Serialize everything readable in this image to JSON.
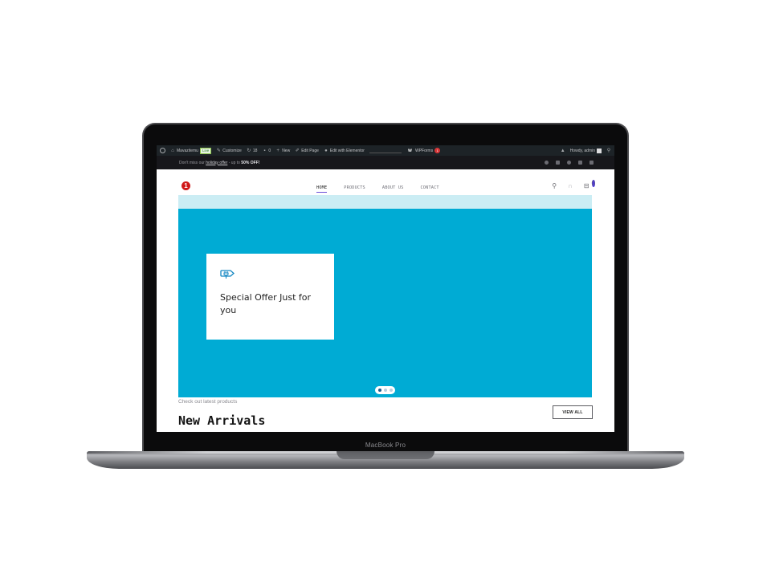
{
  "device": {
    "label": "MacBook Pro"
  },
  "admin_bar": {
    "site_name": "Mavazitemu",
    "live_badge": "Live",
    "customize": "Customize",
    "updates_count": "18",
    "comments_count": "0",
    "new_label": "New",
    "edit_page": "Edit Page",
    "edit_elementor": "Edit with Elementor",
    "wpforms": "WPForms",
    "wpforms_badge": "1",
    "howdy": "Howdy, admin"
  },
  "notice": {
    "prefix": "Don't miss our ",
    "link": "holiday offer",
    "middle": " - up to ",
    "highlight": "50% OFF!"
  },
  "social_icons": [
    "facebook-icon",
    "twitter-icon",
    "instagram-icon",
    "youtube-icon",
    "email-icon"
  ],
  "header": {
    "logo_glyph": "1",
    "nav": [
      {
        "label": "HOME",
        "active": true
      },
      {
        "label": "PRODUCTS",
        "active": false
      },
      {
        "label": "ABOUT US",
        "active": false
      },
      {
        "label": "CONTACT",
        "active": false
      }
    ],
    "cart_count": "0"
  },
  "hero": {
    "offer_title": "Special Offer Just for you",
    "slides_total": 3,
    "active_slide": 1,
    "colors": {
      "hero_bg": "#00abd4",
      "strip": "#cbedf4"
    }
  },
  "products_section": {
    "subtitle": "Check out latest products",
    "title": "New Arrivals",
    "view_all": "VIEW ALL"
  },
  "colors": {
    "accent": "#6a4fd8",
    "logo_red": "#d01818",
    "cart_badge": "#4b34e0"
  }
}
